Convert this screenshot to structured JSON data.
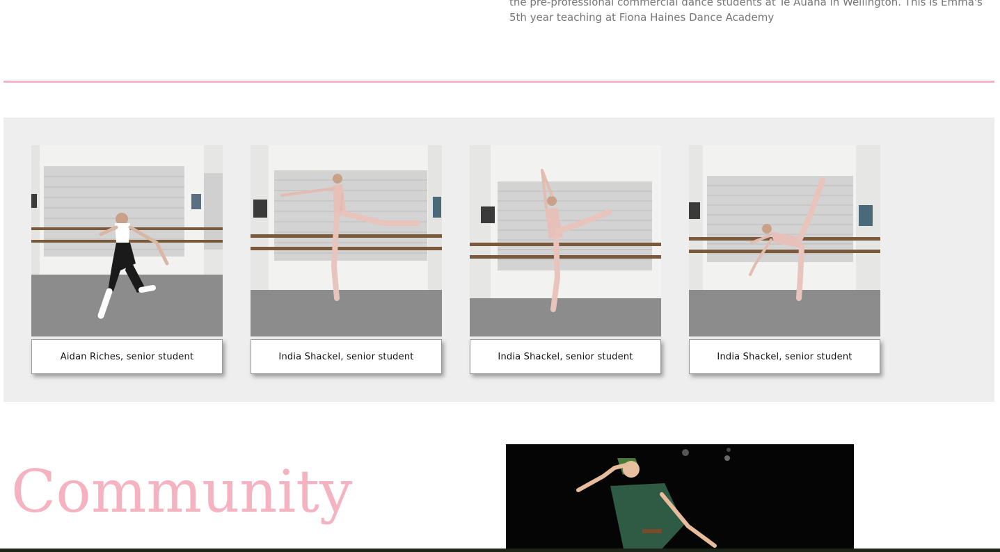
{
  "intro": {
    "text_line1": "the pre-professional commercial dance students at Te Auaha in Wellington. This is Emma's",
    "text_line2": "5th year teaching at Fiona Haines Dance Academy"
  },
  "gallery": {
    "items": [
      {
        "caption": "Aidan Riches, senior student"
      },
      {
        "caption": "India Shackel, senior student"
      },
      {
        "caption": "India Shackel, senior student"
      },
      {
        "caption": "India Shackel, senior student"
      }
    ]
  },
  "community": {
    "heading": "Community"
  },
  "colors": {
    "accent_pink": "#f4b4c3",
    "gallery_bg": "#eeeeee",
    "text_gray": "#777777"
  }
}
